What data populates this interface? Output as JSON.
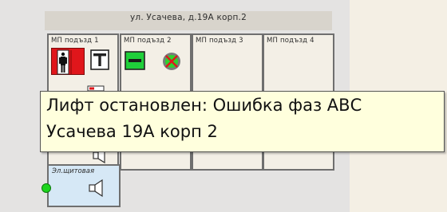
{
  "building": {
    "address": "ул. Усачева, д.19А корп.2",
    "entrances": [
      {
        "title": "МП подъзд 1"
      },
      {
        "title": "МП подъзд 2"
      },
      {
        "title": "МП подъзд 3"
      },
      {
        "title": "МП подъзд 4"
      }
    ],
    "electrical_room": {
      "title": "Эл.щитовая"
    }
  },
  "tooltip": {
    "line1": "Лифт остановлен: Ошибка фаз АВС",
    "line2": "Усачева 19А корп 2"
  },
  "icons": {
    "elevator": "elevator-alarm-icon",
    "terminal": "terminal-icon",
    "panel": "control-panel-icon",
    "sensor": "sensor-alarm-icon",
    "speaker": "speaker-icon"
  },
  "colors": {
    "alarm_red": "#e0161b",
    "status_green": "#1dd41d",
    "tooltip_bg": "#ffffdd"
  }
}
